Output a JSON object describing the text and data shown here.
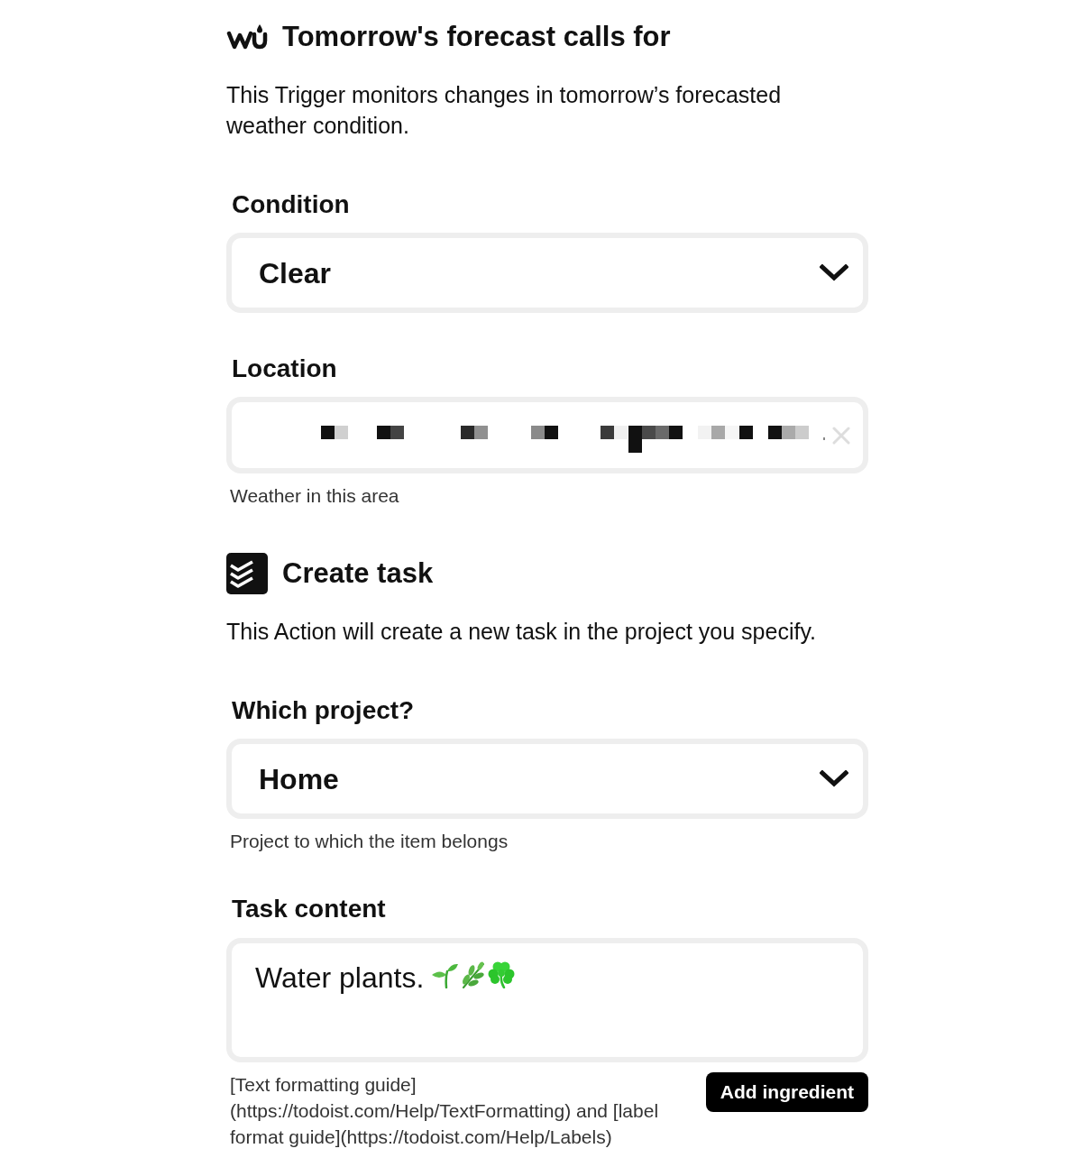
{
  "trigger": {
    "title": "Tomorrow's forecast calls for",
    "description": "This Trigger monitors changes in tomorrow’s forecasted weather condition."
  },
  "trigger_fields": [
    {
      "kind": "select",
      "label": "Condition",
      "value": "Clear"
    },
    {
      "kind": "location",
      "label": "Location",
      "helper": "Weather in this area"
    }
  ],
  "action": {
    "title": "Create task",
    "description": "This Action will create a new task in the project you specify."
  },
  "action_fields": [
    {
      "kind": "select",
      "label": "Which project?",
      "value": "Home",
      "helper": "Project to which the item belongs"
    },
    {
      "kind": "textarea",
      "label": "Task content",
      "value": "Water plants.",
      "helper": "[Text formatting guide](https://todoist.com/Help/TextFormatting) and [label format guide](https://todoist.com/Help/Labels)",
      "button": "Add ingredient"
    }
  ]
}
